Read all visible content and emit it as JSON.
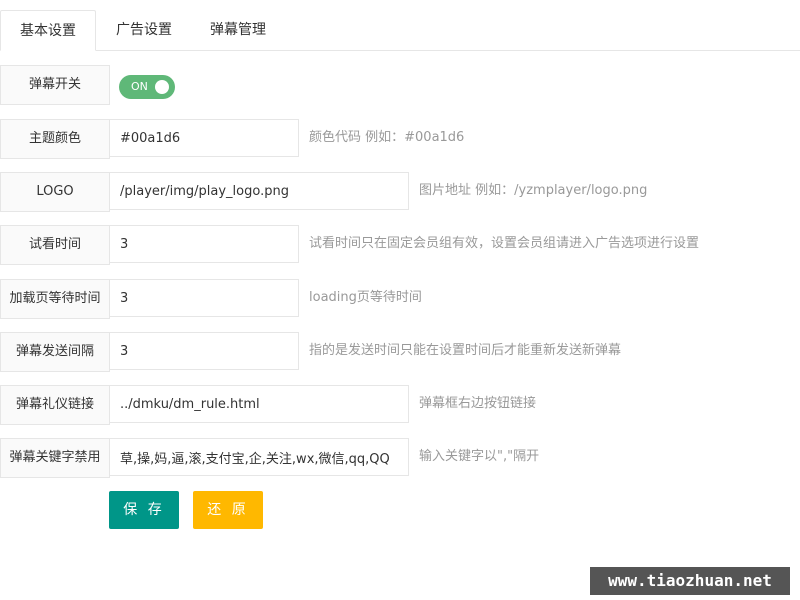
{
  "tabs": [
    {
      "label": "基本设置",
      "active": true
    },
    {
      "label": "广告设置",
      "active": false
    },
    {
      "label": "弹幕管理",
      "active": false
    }
  ],
  "form": {
    "danmaku_switch": {
      "label": "弹幕开关",
      "state": "ON",
      "on": true
    },
    "theme_color": {
      "label": "主题颜色",
      "value": "#00a1d6",
      "hint": "颜色代码 例如：#00a1d6"
    },
    "logo": {
      "label": "LOGO",
      "value": "/player/img/play_logo.png",
      "hint": "图片地址 例如：/yzmplayer/logo.png"
    },
    "trial_time": {
      "label": "试看时间",
      "value": "3",
      "hint": "试看时间只在固定会员组有效，设置会员组请进入广告选项进行设置"
    },
    "loading_wait": {
      "label": "加载页等待时间",
      "value": "3",
      "hint": "loading页等待时间"
    },
    "danmaku_interval": {
      "label": "弹幕发送间隔",
      "value": "3",
      "hint": "指的是发送时间只能在设置时间后才能重新发送新弹幕"
    },
    "danmaku_rule_link": {
      "label": "弹幕礼仪链接",
      "value": "../dmku/dm_rule.html",
      "hint": "弹幕框右边按钮链接"
    },
    "danmaku_keywords": {
      "label": "弹幕关键字禁用",
      "value": "草,操,妈,逼,滚,支付宝,企,关注,wx,微信,qq,QQ",
      "hint": "输入关键字以\",\"隔开"
    }
  },
  "buttons": {
    "save": "保 存",
    "reset": "还 原"
  },
  "watermark": "www.tiaozhuan.net",
  "colors": {
    "switch_on": "#5fb878",
    "save": "#009688",
    "reset": "#ffb800"
  }
}
